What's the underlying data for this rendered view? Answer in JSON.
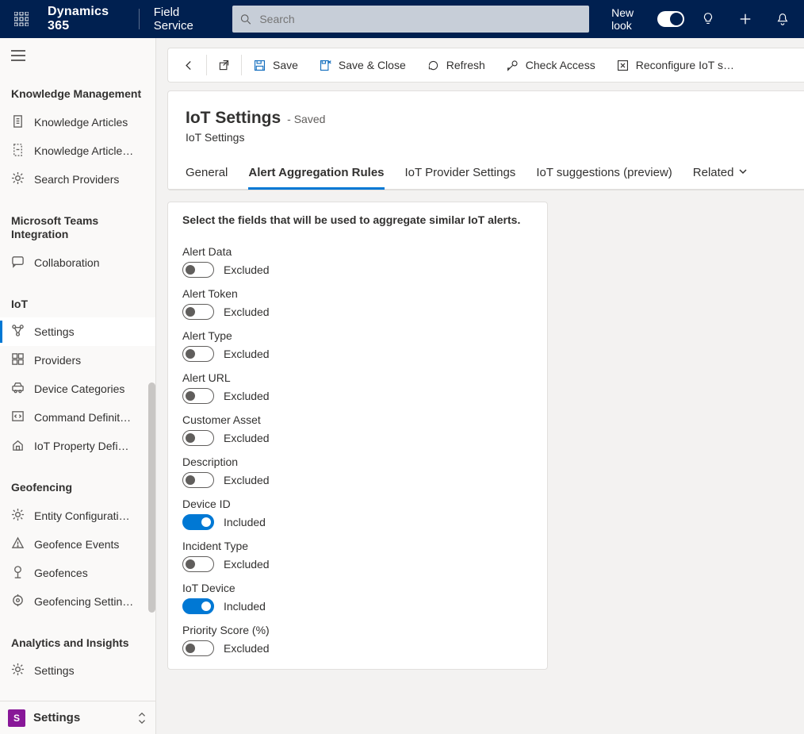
{
  "topbar": {
    "product": "Dynamics 365",
    "area": "Field Service",
    "search_placeholder": "Search",
    "newlook": "New look"
  },
  "sidebar": {
    "sections": [
      {
        "title": "Knowledge Management",
        "items": [
          {
            "label": "Knowledge Articles",
            "icon": "doc"
          },
          {
            "label": "Knowledge Article…",
            "icon": "doc-dash"
          },
          {
            "label": "Search Providers",
            "icon": "gear"
          }
        ]
      },
      {
        "title": "Microsoft Teams Integration",
        "items": [
          {
            "label": "Collaboration",
            "icon": "chat"
          }
        ]
      },
      {
        "title": "IoT",
        "items": [
          {
            "label": "Settings",
            "icon": "nodes",
            "active": true
          },
          {
            "label": "Providers",
            "icon": "grid-box"
          },
          {
            "label": "Device Categories",
            "icon": "car"
          },
          {
            "label": "Command Definit…",
            "icon": "code-box"
          },
          {
            "label": "IoT Property Defi…",
            "icon": "house"
          }
        ]
      },
      {
        "title": "Geofencing",
        "items": [
          {
            "label": "Entity Configurati…",
            "icon": "gear"
          },
          {
            "label": "Geofence Events",
            "icon": "alert"
          },
          {
            "label": "Geofences",
            "icon": "pin"
          },
          {
            "label": "Geofencing Settin…",
            "icon": "target"
          }
        ]
      },
      {
        "title": "Analytics and Insights",
        "items": [
          {
            "label": "Settings",
            "icon": "gear"
          }
        ]
      }
    ],
    "area_switch": {
      "initial": "S",
      "label": "Settings"
    }
  },
  "commands": {
    "save": "Save",
    "save_close": "Save & Close",
    "refresh": "Refresh",
    "check_access": "Check Access",
    "reconfigure": "Reconfigure IoT sugge…"
  },
  "page": {
    "title": "IoT Settings",
    "suffix": "- Saved",
    "subtitle": "IoT Settings",
    "tabs": [
      {
        "label": "General"
      },
      {
        "label": "Alert Aggregation Rules",
        "active": true
      },
      {
        "label": "IoT Provider Settings"
      },
      {
        "label": "IoT suggestions (preview)"
      },
      {
        "label": "Related",
        "dropdown": true
      }
    ]
  },
  "card": {
    "instruction": "Select the fields that will be used to aggregate similar IoT alerts.",
    "state_on": "Included",
    "state_off": "Excluded",
    "fields": [
      {
        "label": "Alert Data",
        "on": false
      },
      {
        "label": "Alert Token",
        "on": false
      },
      {
        "label": "Alert Type",
        "on": false
      },
      {
        "label": "Alert URL",
        "on": false
      },
      {
        "label": "Customer Asset",
        "on": false
      },
      {
        "label": "Description",
        "on": false
      },
      {
        "label": "Device ID",
        "on": true
      },
      {
        "label": "Incident Type",
        "on": false
      },
      {
        "label": "IoT Device",
        "on": true
      },
      {
        "label": "Priority Score (%)",
        "on": false
      }
    ]
  }
}
